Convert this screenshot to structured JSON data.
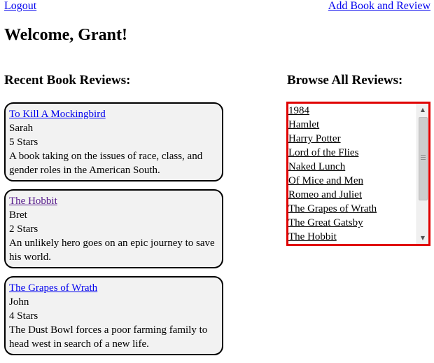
{
  "header": {
    "logout_label": "Logout",
    "add_label": "Add Book and Review",
    "welcome": "Welcome, Grant!"
  },
  "recent": {
    "title": "Recent Book Reviews:",
    "reviews": [
      {
        "book": "To Kill A Mockingbird",
        "reviewer": "Sarah",
        "stars": "5 Stars",
        "summary": "A book taking on the issues of race, class, and gender roles in the American South."
      },
      {
        "book": "The Hobbit",
        "reviewer": "Bret",
        "stars": "2 Stars",
        "summary": "An unlikely hero goes on an epic journey to save his world."
      },
      {
        "book": "The Grapes of Wrath",
        "reviewer": "John",
        "stars": "4 Stars",
        "summary": "The Dust Bowl forces a poor farming family to head west in search of a new life."
      }
    ]
  },
  "browse": {
    "title": "Browse All Reviews:",
    "books": [
      "1984",
      "Hamlet",
      "Harry Potter",
      "Lord of the Flies",
      "Naked Lunch",
      "Of Mice and Men",
      "Romeo and Juliet",
      "The Grapes of Wrath",
      "The Great Gatsby",
      "The Hobbit"
    ],
    "border_color": "#e00000"
  },
  "icons": {
    "scroll_up": "scroll-up-arrow-icon",
    "scroll_down": "scroll-down-arrow-icon"
  }
}
